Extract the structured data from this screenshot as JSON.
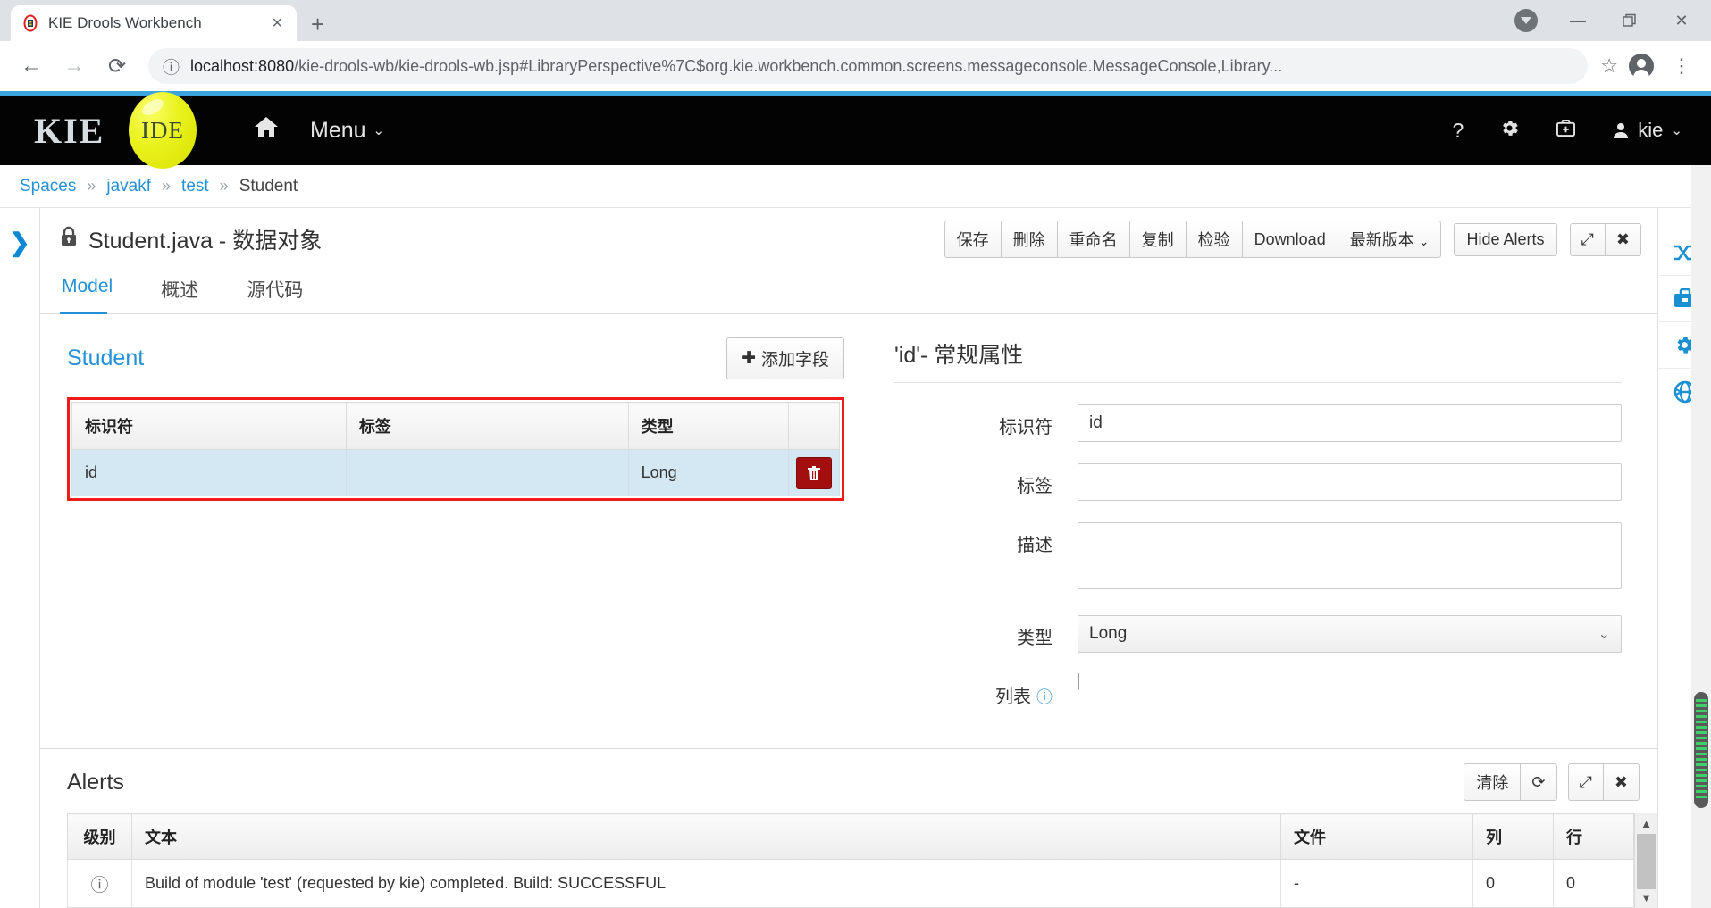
{
  "browser": {
    "tab_title": "KIE Drools Workbench",
    "tab_close": "×",
    "new_tab": "+",
    "back_icon": "←",
    "forward_icon": "→",
    "reload_icon": "⟳",
    "info_icon": "ⓘ",
    "url_host": "localhost:8080",
    "url_path": "/kie-drools-wb/kie-drools-wb.jsp#LibraryPerspective%7C$org.kie.workbench.common.screens.messageconsole.MessageConsole,Library...",
    "star_icon": "☆",
    "kebab_icon": "⋮",
    "minimize": "—",
    "maximize": "❐",
    "close": "✕"
  },
  "kie_header": {
    "logo_word": "KIE",
    "logo_ball": "IDE",
    "home_icon": "⌂",
    "menu_label": "Menu",
    "menu_caret": "⌄",
    "help_icon": "?",
    "gear_icon": "⚙",
    "kit_icon": "⚕",
    "user_icon": "●",
    "user_name": "kie",
    "user_caret": "⌄"
  },
  "breadcrumb": {
    "sep": "»",
    "items": [
      {
        "label": "Spaces",
        "current": false
      },
      {
        "label": "javakf",
        "current": false
      },
      {
        "label": "test",
        "current": false
      },
      {
        "label": "Student",
        "current": true
      }
    ]
  },
  "rail_left": {
    "expand_icon": "❯"
  },
  "rail_right": {
    "items": [
      {
        "icon": "⇄",
        "name": "shuffle-icon"
      },
      {
        "icon": "Ὃc",
        "name": "briefcase-icon"
      },
      {
        "icon": "⚙",
        "name": "gear-icon"
      },
      {
        "icon": "◑",
        "name": "globe-icon"
      }
    ]
  },
  "editor": {
    "lock_icon": "🔒",
    "title": "Student.java - 数据对象",
    "toolbar": {
      "group": [
        "保存",
        "删除",
        "重命名",
        "复制",
        "检验",
        "Download"
      ],
      "version_label": "最新版本",
      "version_caret": "⌄",
      "hide_alerts": "Hide Alerts",
      "expand_icon": "⤢",
      "close_icon": "✖"
    },
    "tabs": [
      {
        "label": "Model",
        "active": true
      },
      {
        "label": "概述",
        "active": false
      },
      {
        "label": "源代码",
        "active": false
      }
    ]
  },
  "model_pane": {
    "title": "Student",
    "add_field_plus": "✚",
    "add_field_label": "添加字段",
    "columns": [
      "标识符",
      "标签",
      "",
      "类型",
      ""
    ],
    "rows": [
      {
        "identifier": "id",
        "label": "",
        "type": "Long",
        "delete_icon": "🗑"
      }
    ]
  },
  "properties": {
    "title": "'id'- 常规属性",
    "fields": {
      "identifier_label": "标识符",
      "identifier_value": "id",
      "label_label": "标签",
      "label_value": "",
      "description_label": "描述",
      "description_value": "",
      "type_label": "类型",
      "type_value": "Long",
      "type_caret": "⌄",
      "list_label": "列表",
      "list_info_icon": "ⓘ",
      "list_checked": false
    }
  },
  "alerts": {
    "title": "Alerts",
    "clear_label": "清除",
    "refresh_icon": "⟳",
    "expand_icon": "⤢",
    "close_icon": "✖",
    "columns": [
      "级别",
      "文本",
      "文件",
      "列",
      "行"
    ],
    "rows": [
      {
        "level_icon": "ⓘ",
        "text": "Build of module 'test' (requested by kie) completed. Build: SUCCESSFUL",
        "file": "-",
        "column": "0",
        "line": "0"
      }
    ],
    "scroll_up": "▲",
    "scroll_down": "▼"
  },
  "colors": {
    "accent_blue": "#2491d6",
    "header_black": "#030303",
    "logo_yellow": "#e9f21c",
    "row_highlight": "#d3e8f2",
    "annotation_red": "#ee1b1b",
    "delete_red": "#a30e0e"
  }
}
